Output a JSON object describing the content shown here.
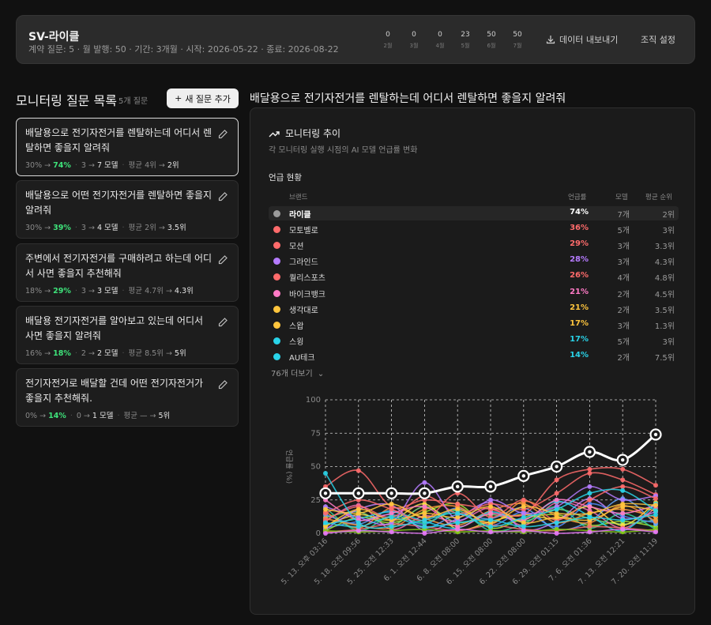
{
  "header": {
    "title": "SV-라이클",
    "meta": "계약 질문: 5 · 월 발행: 50 · 기간: 3개월 · 시작: 2026-05-22 · 종료: 2026-08-22",
    "months": [
      {
        "count": "0",
        "label": "2월"
      },
      {
        "count": "0",
        "label": "3월"
      },
      {
        "count": "0",
        "label": "4월"
      },
      {
        "count": "23",
        "label": "5월"
      },
      {
        "count": "50",
        "label": "6월"
      },
      {
        "count": "50",
        "label": "7월"
      }
    ],
    "export_label": "데이터 내보내기",
    "org_label": "조직 설정"
  },
  "list": {
    "title": "모니터링 질문 목록",
    "count": "5개 질문",
    "add_label": "새 질문 추가",
    "questions": [
      {
        "text": "배달용으로 전기자전거를 렌탈하는데 어디서 렌탈하면 좋을지 알려줘",
        "rate_from": "30%",
        "rate_to": "74%",
        "model_from": "3",
        "model_to": "7",
        "rank_from": "4위",
        "rank_to": "2위"
      },
      {
        "text": "배달용으로 어떤 전기자전거를 렌탈하면 좋을지 알려줘",
        "rate_from": "30%",
        "rate_to": "39%",
        "model_from": "3",
        "model_to": "4",
        "rank_from": "2위",
        "rank_to": "3.5위"
      },
      {
        "text": "주변에서 전기자전거를 구매하려고 하는데 어디서 사면 좋을지 추천해줘",
        "rate_from": "18%",
        "rate_to": "29%",
        "model_from": "3",
        "model_to": "3",
        "rank_from": "4.7위",
        "rank_to": "4.3위"
      },
      {
        "text": "배달용 전기자전거를 알아보고 있는데 어디서 사면 좋을지 알려줘",
        "rate_from": "16%",
        "rate_to": "18%",
        "model_from": "2",
        "model_to": "2",
        "rank_from": "8.5위",
        "rank_to": "5위"
      },
      {
        "text": "전기자전거로 배달할 건데 어떤 전기자전거가 좋을지 추천해줘.",
        "rate_from": "0%",
        "rate_to": "14%",
        "model_from": "0",
        "model_to": "1",
        "rank_from": "—",
        "rank_to": "5위"
      }
    ],
    "model_word": "모델",
    "avg_word": "평균"
  },
  "detail": {
    "title": "배달용으로 전기자전거를 렌탈하는데 어디서 렌탈하면 좋을지 알려줘",
    "panel_title": "모니터링 추이",
    "panel_sub": "각 모니터링 실행 시점의 AI 모델 언급률 변화",
    "mention_title": "언급 현황",
    "columns": {
      "brand": "브랜드",
      "rate": "언급률",
      "models": "모델",
      "rank": "평균 순위"
    },
    "brands": [
      {
        "name": "라이클",
        "rate": "74%",
        "models": "7개",
        "rank": "2위",
        "color": "#9a9a9a",
        "highlight": true
      },
      {
        "name": "모토벨로",
        "rate": "36%",
        "models": "5개",
        "rank": "3위",
        "color": "#ff6b6b"
      },
      {
        "name": "모션",
        "rate": "29%",
        "models": "3개",
        "rank": "3.3위",
        "color": "#ff6b6b"
      },
      {
        "name": "그라인드",
        "rate": "28%",
        "models": "3개",
        "rank": "4.3위",
        "color": "#b57bff"
      },
      {
        "name": "퀄리스포츠",
        "rate": "26%",
        "models": "4개",
        "rank": "4.8위",
        "color": "#ff6b6b"
      },
      {
        "name": "바이크뱅크",
        "rate": "21%",
        "models": "2개",
        "rank": "4.5위",
        "color": "#ff7ac6"
      },
      {
        "name": "생각대로",
        "rate": "21%",
        "models": "2개",
        "rank": "3.5위",
        "color": "#ffc53d"
      },
      {
        "name": "스왑",
        "rate": "17%",
        "models": "3개",
        "rank": "1.3위",
        "color": "#ffc53d"
      },
      {
        "name": "스윙",
        "rate": "17%",
        "models": "5개",
        "rank": "3위",
        "color": "#29d3e8"
      },
      {
        "name": "AU테크",
        "rate": "14%",
        "models": "2개",
        "rank": "7.5위",
        "color": "#29d3e8"
      }
    ],
    "more_label": "76개 더보기"
  },
  "chart_data": {
    "type": "line",
    "ylabel": "언급률 (%)",
    "ylim": [
      0,
      100
    ],
    "yticks": [
      0,
      25,
      50,
      75,
      100
    ],
    "categories": [
      "5. 13. 오후 03:16",
      "5. 18. 오전 09:56",
      "5. 25. 오전 12:33",
      "6. 1. 오전 12:44",
      "6. 8. 오전 08:00",
      "6. 15. 오전 08:00",
      "6. 22. 오전 08:00",
      "6. 29. 오전 01:15",
      "7. 6. 오전 01:36",
      "7. 13. 오전 12:21",
      "7. 20. 오전 11:19"
    ],
    "series": [
      {
        "name": "라이클",
        "color": "#ffffff",
        "values": [
          30,
          30,
          30,
          30,
          35,
          35,
          43,
          50,
          61,
          55,
          74
        ]
      },
      {
        "name": "모토벨로",
        "color": "#ff6b6b",
        "values": [
          35,
          47,
          20,
          25,
          22,
          18,
          14,
          40,
          48,
          48,
          36
        ]
      },
      {
        "name": "모션",
        "color": "#ff6b6b",
        "values": [
          10,
          20,
          12,
          28,
          15,
          22,
          18,
          30,
          45,
          40,
          29
        ]
      },
      {
        "name": "그라인드",
        "color": "#b57bff",
        "values": [
          20,
          12,
          8,
          38,
          10,
          25,
          15,
          20,
          35,
          25,
          28
        ]
      },
      {
        "name": "퀄리스포츠",
        "color": "#ff6b6b",
        "values": [
          15,
          25,
          18,
          10,
          30,
          12,
          25,
          10,
          25,
          35,
          26
        ]
      },
      {
        "name": "바이크뱅크",
        "color": "#ff7ac6",
        "values": [
          25,
          10,
          15,
          20,
          5,
          15,
          10,
          25,
          20,
          15,
          21
        ]
      },
      {
        "name": "생각대로",
        "color": "#ffc53d",
        "values": [
          18,
          15,
          22,
          12,
          18,
          8,
          20,
          15,
          15,
          22,
          21
        ]
      },
      {
        "name": "스왑",
        "color": "#ffc53d",
        "values": [
          5,
          18,
          10,
          15,
          12,
          20,
          8,
          12,
          10,
          20,
          17
        ]
      },
      {
        "name": "스윙",
        "color": "#29d3e8",
        "values": [
          45,
          8,
          5,
          10,
          15,
          5,
          12,
          18,
          30,
          32,
          17
        ]
      },
      {
        "name": "AU테크",
        "color": "#29d3e8",
        "values": [
          8,
          5,
          12,
          5,
          8,
          10,
          5,
          8,
          12,
          10,
          14
        ]
      }
    ],
    "background_series": [
      {
        "color": "#7ee081",
        "values": [
          12,
          16,
          6,
          20,
          8,
          14,
          9,
          18,
          11,
          7,
          10
        ]
      },
      {
        "color": "#4d8dff",
        "values": [
          4,
          9,
          14,
          7,
          19,
          6,
          16,
          5,
          22,
          13,
          8
        ]
      },
      {
        "color": "#ff9f43",
        "values": [
          16,
          4,
          19,
          11,
          6,
          17,
          22,
          8,
          15,
          18,
          12
        ]
      },
      {
        "color": "#a3e635",
        "values": [
          2,
          12,
          8,
          16,
          22,
          4,
          11,
          14,
          6,
          9,
          5
        ]
      },
      {
        "color": "#f472b6",
        "values": [
          9,
          21,
          3,
          13,
          9,
          19,
          6,
          23,
          17,
          4,
          19
        ]
      },
      {
        "color": "#60a5fa",
        "values": [
          14,
          7,
          17,
          4,
          14,
          11,
          19,
          3,
          9,
          26,
          7
        ]
      },
      {
        "color": "#fde047",
        "values": [
          6,
          14,
          10,
          22,
          3,
          9,
          14,
          11,
          20,
          6,
          23
        ]
      },
      {
        "color": "#34d399",
        "values": [
          19,
          2,
          13,
          8,
          17,
          2,
          7,
          20,
          4,
          15,
          3
        ]
      },
      {
        "color": "#c084fc",
        "values": [
          3,
          18,
          21,
          2,
          11,
          23,
          3,
          9,
          26,
          11,
          16
        ]
      },
      {
        "color": "#fb923c",
        "values": [
          11,
          6,
          4,
          18,
          20,
          7,
          24,
          13,
          8,
          21,
          9
        ]
      },
      {
        "color": "#22d3ee",
        "values": [
          7,
          11,
          16,
          9,
          4,
          16,
          10,
          24,
          13,
          2,
          22
        ]
      },
      {
        "color": "#f87171",
        "values": [
          1,
          3,
          7,
          5,
          2,
          6,
          3,
          2,
          5,
          4,
          2
        ]
      },
      {
        "color": "#84cc16",
        "values": [
          2,
          1,
          2,
          3,
          1,
          2,
          1,
          3,
          2,
          1,
          3
        ]
      },
      {
        "color": "#e879f9",
        "values": [
          0,
          2,
          1,
          0,
          3,
          1,
          2,
          0,
          1,
          3,
          1
        ]
      }
    ]
  }
}
